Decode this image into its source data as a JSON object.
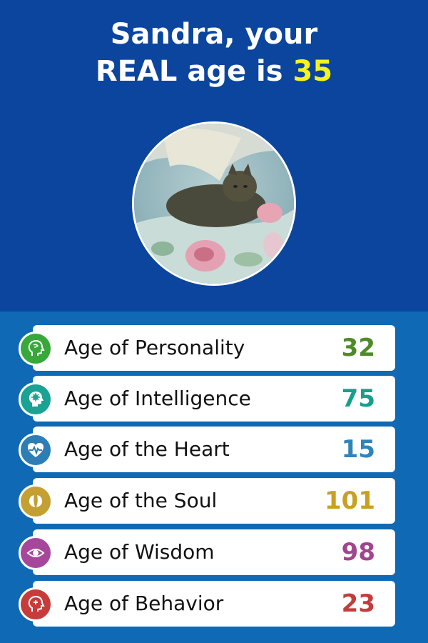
{
  "header": {
    "title_line1": "Sandra, your",
    "title_line2_prefix": "REAL age is ",
    "real_age": "35",
    "real_age_color": "#f5f220"
  },
  "avatar": {
    "description_icon": "cat-photo"
  },
  "ages": [
    {
      "label": "Age of Personality",
      "value": "32",
      "color": "#4f8a2a",
      "icon": "head-icon",
      "icon_bg": "#37a83a"
    },
    {
      "label": "Age of Intelligence",
      "value": "75",
      "color": "#16a08c",
      "icon": "brain-icon",
      "icon_bg": "#1aa294"
    },
    {
      "label": "Age of the Heart",
      "value": "15",
      "color": "#2f84b8",
      "icon": "heart-pulse-icon",
      "icon_bg": "#2d7eb4"
    },
    {
      "label": "Age of the Soul",
      "value": "101",
      "color": "#c9a021",
      "icon": "soul-leaf-icon",
      "icon_bg": "#c4a032"
    },
    {
      "label": "Age of Wisdom",
      "value": "98",
      "color": "#a0468e",
      "icon": "eye-icon",
      "icon_bg": "#a6479b"
    },
    {
      "label": "Age of Behavior",
      "value": "23",
      "color": "#c23d3d",
      "icon": "behavior-head-icon",
      "icon_bg": "#c83b3b"
    }
  ]
}
